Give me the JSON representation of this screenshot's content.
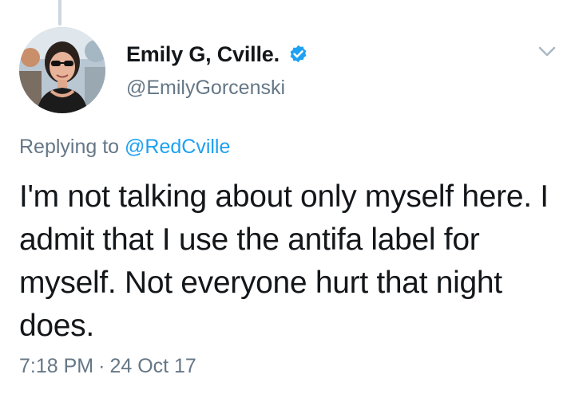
{
  "author": {
    "display_name": "Emily G, Cville.",
    "handle": "@EmilyGorcenski",
    "verified_icon": "verified-badge-icon"
  },
  "reply": {
    "prefix": "Replying to",
    "to_handle": "@RedCville"
  },
  "tweet": {
    "text": "I'm not talking about only myself here. I admit that I use the antifa label for myself. Not everyone hurt that night does."
  },
  "meta": {
    "time": "7:18 PM",
    "separator": "·",
    "date": "24 Oct 17"
  },
  "colors": {
    "verified_blue": "#1da1f2",
    "link_blue": "#1da1f2",
    "secondary_gray": "#657786",
    "text_dark": "#14171a",
    "thread_line": "#ccd6dd"
  },
  "icons": {
    "caret": "chevron-down-icon",
    "avatar": "avatar"
  }
}
